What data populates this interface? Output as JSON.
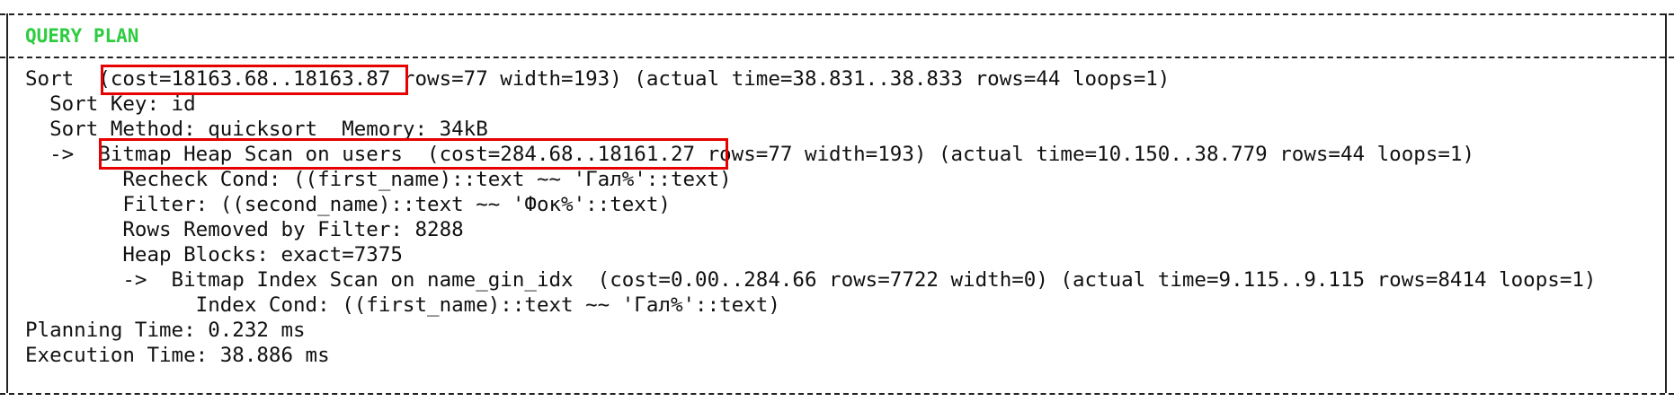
{
  "header": {
    "title": "QUERY PLAN"
  },
  "plan": {
    "lines": [
      "Sort  (cost=18163.68..18163.87 rows=77 width=193) (actual time=38.831..38.833 rows=44 loops=1)",
      "  Sort Key: id",
      "  Sort Method: quicksort  Memory: 34kB",
      "  ->  Bitmap Heap Scan on users  (cost=284.68..18161.27 rows=77 width=193) (actual time=10.150..38.779 rows=44 loops=1)",
      "        Recheck Cond: ((first_name)::text ~~ 'Гал%'::text)",
      "        Filter: ((second_name)::text ~~ 'Фок%'::text)",
      "        Rows Removed by Filter: 8288",
      "        Heap Blocks: exact=7375",
      "        ->  Bitmap Index Scan on name_gin_idx  (cost=0.00..284.66 rows=7722 width=0) (actual time=9.115..9.115 rows=8414 loops=1)",
      "              Index Cond: ((first_name)::text ~~ 'Гал%'::text)",
      "Planning Time: 0.232 ms",
      "Execution Time: 38.886 ms"
    ]
  },
  "highlights": [
    "sort-cost",
    "heap-scan-cost"
  ],
  "colors": {
    "highlight": "#e60000",
    "header": "#2ecc40",
    "text": "#111111"
  }
}
